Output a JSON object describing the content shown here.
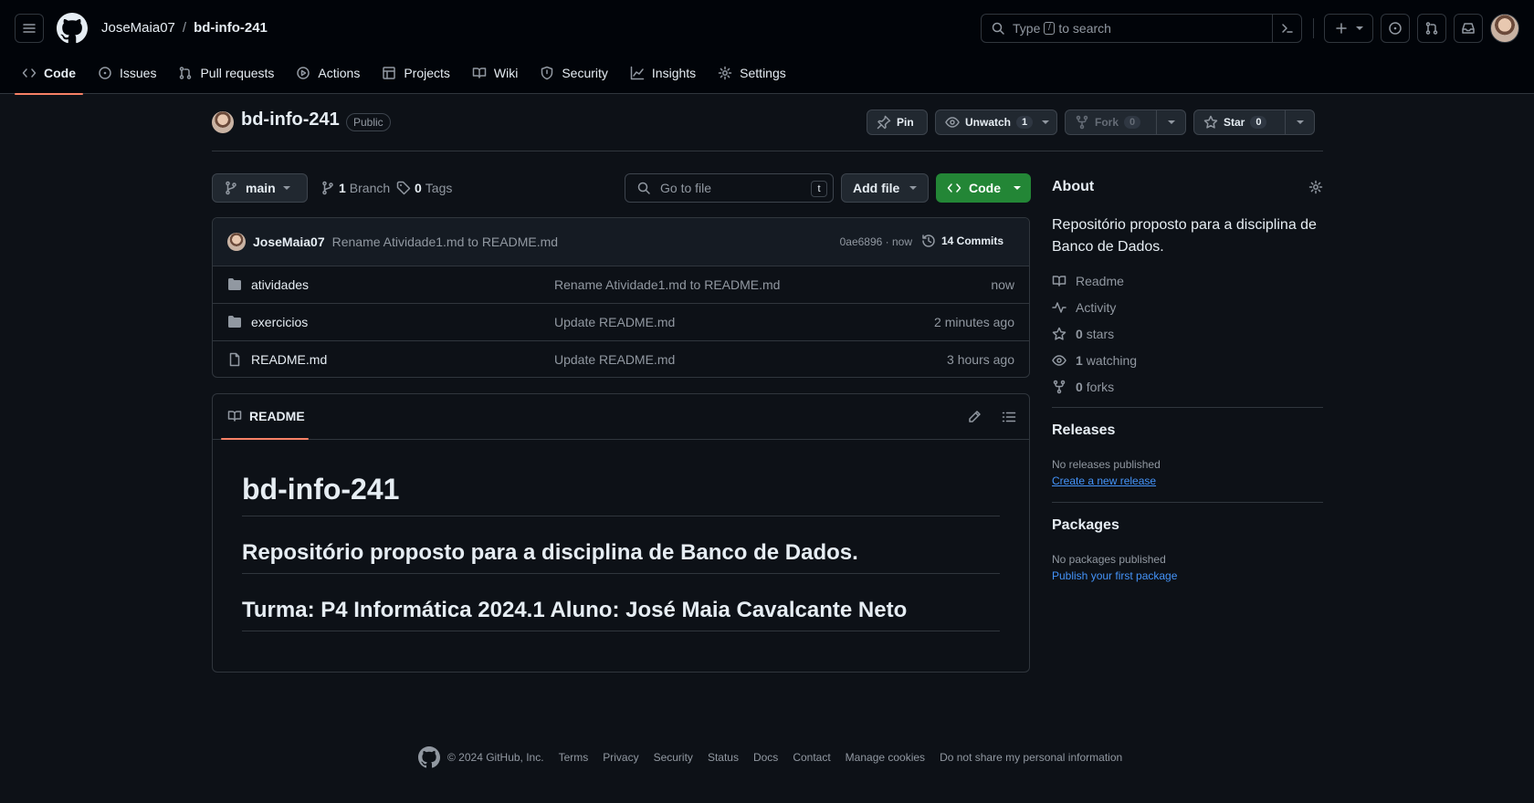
{
  "header": {
    "owner": "JoseMaia07",
    "separator": "/",
    "repo": "bd-info-241",
    "search_prefix": "Type",
    "search_key": "/",
    "search_suffix": "to search"
  },
  "tabs": [
    {
      "label": "Code",
      "icon": "code-icon"
    },
    {
      "label": "Issues",
      "icon": "issue-icon"
    },
    {
      "label": "Pull requests",
      "icon": "pull-request-icon"
    },
    {
      "label": "Actions",
      "icon": "play-icon"
    },
    {
      "label": "Projects",
      "icon": "table-icon"
    },
    {
      "label": "Wiki",
      "icon": "book-icon"
    },
    {
      "label": "Security",
      "icon": "shield-icon"
    },
    {
      "label": "Insights",
      "icon": "graph-icon"
    },
    {
      "label": "Settings",
      "icon": "gear-icon"
    }
  ],
  "repo": {
    "name": "bd-info-241",
    "visibility": "Public",
    "pin": "Pin",
    "unwatch": "Unwatch",
    "watch_count": "1",
    "fork": "Fork",
    "fork_count": "0",
    "star": "Star",
    "star_count": "0"
  },
  "filenav": {
    "branch": "main",
    "branches_count": "1",
    "branches_label": "Branch",
    "tags_count": "0",
    "tags_label": "Tags",
    "goto_placeholder": "Go to file",
    "goto_key": "t",
    "add_file": "Add file",
    "code": "Code"
  },
  "commit": {
    "user": "JoseMaia07",
    "message": "Rename Atividade1.md to README.md",
    "hash": "0ae6896 · now",
    "commits": "14 Commits"
  },
  "files": [
    {
      "name": "atividades",
      "type": "folder",
      "message": "Rename Atividade1.md to README.md",
      "age": "now"
    },
    {
      "name": "exercicios",
      "type": "folder",
      "message": "Update README.md",
      "age": "2 minutes ago"
    },
    {
      "name": "README.md",
      "type": "file",
      "message": "Update README.md",
      "age": "3 hours ago"
    }
  ],
  "readme": {
    "tab": "README",
    "h1": "bd-info-241",
    "h2a": "Repositório proposto para a disciplina de Banco de Dados.",
    "h2b": "Turma: P4 Informática 2024.1 Aluno: José Maia Cavalcante Neto"
  },
  "about": {
    "title": "About",
    "description": "Repositório proposto para a disciplina de Banco de Dados.",
    "items": [
      {
        "icon": "book-icon",
        "count": "",
        "label": "Readme"
      },
      {
        "icon": "pulse-icon",
        "count": "",
        "label": "Activity"
      },
      {
        "icon": "star-icon",
        "count": "0",
        "label": "stars"
      },
      {
        "icon": "eye-icon",
        "count": "1",
        "label": "watching"
      },
      {
        "icon": "fork-icon",
        "count": "0",
        "label": "forks"
      }
    ]
  },
  "releases": {
    "title": "Releases",
    "none": "No releases published",
    "link": "Create a new release"
  },
  "packages": {
    "title": "Packages",
    "none": "No packages published",
    "link": "Publish your first package"
  },
  "footer": {
    "copyright": "© 2024 GitHub, Inc.",
    "links": [
      "Terms",
      "Privacy",
      "Security",
      "Status",
      "Docs",
      "Contact",
      "Manage cookies",
      "Do not share my personal information"
    ]
  },
  "colors": {
    "background": "#0d1117",
    "accent_tab": "#f78166",
    "code_button": "#238636",
    "link": "#4493f8"
  }
}
